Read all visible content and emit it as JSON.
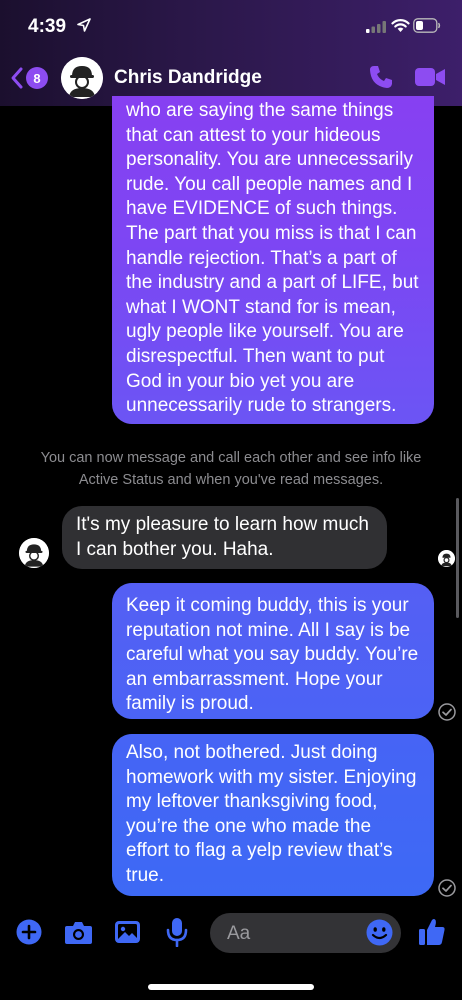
{
  "status_bar": {
    "time": "4:39"
  },
  "header": {
    "unread_count": "8",
    "contact_name": "Chris Dandridge"
  },
  "messages": {
    "out1": "who are saying the same things\nthat can attest to your hideous\npersonality. You are unnecessarily\nrude. You call people names and I\nhave EVIDENCE of such things.\nThe part that you miss is that I can\nhandle rejection. That’s a part of\nthe industry and a part of LIFE, but\nwhat I WONT stand for is mean,\nugly people like yourself. You are\ndisrespectful. Then want to put\nGod in your bio yet you are\nunnecessarily rude to strangers.",
    "system": "You can now message and call each other and see info like\nActive Status and when you've read messages.",
    "in1": "It's my pleasure to learn how much\nI can bother you. Haha.",
    "out2": "Keep it coming buddy, this is your\nreputation not mine. All I say is be\ncareful what you say buddy. You’re\nan embarrassment. Hope your\nfamily is proud.",
    "out3": "Also, not bothered. Just doing\nhomework with my sister. Enjoying\nmy leftover thanksgiving food,\nyou’re the one who made the\neffort to flag a yelp review that’s\ntrue."
  },
  "composer": {
    "placeholder": "Aa"
  },
  "colors": {
    "accent": "#8d4cf1",
    "blue": "#3f68f5",
    "incoming": "#303033"
  },
  "icons": [
    "location-arrow-icon",
    "signal-icon",
    "wifi-icon",
    "battery-icon",
    "back-chevron-icon",
    "phone-icon",
    "video-camera-icon",
    "plus-icon",
    "camera-icon",
    "gallery-icon",
    "microphone-icon",
    "emoji-icon",
    "thumbs-up-icon",
    "delivered-check-icon"
  ]
}
